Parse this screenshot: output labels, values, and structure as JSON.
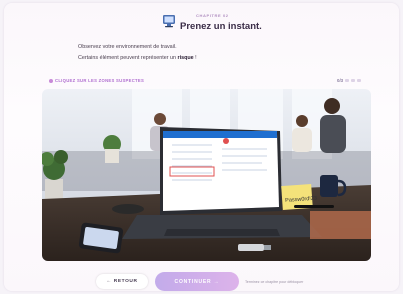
{
  "header": {
    "chapter_label": "CHAPITRE 02",
    "title": "Prenez un instant."
  },
  "intro": {
    "line1": "Observez votre environnement de travail.",
    "line2_prefix": "Certains élément peuvent représenter un ",
    "line2_bold": "risque",
    "line2_suffix": " !"
  },
  "hint": "CLIQUEZ SUR LES ZONES SUSPECTES",
  "progress": {
    "label": "0/3",
    "found": 0,
    "total": 3
  },
  "scene": {
    "sticky_note": "Passw0rd!23",
    "colors": {
      "sky": "#dfe6f0",
      "desk": "#3a2f2a",
      "laptop": "#2b2d33",
      "screen": "#ffffff",
      "accent": "#1f6fd0"
    },
    "icons": [
      "laptop",
      "smartphone",
      "sticky-note",
      "usb-key",
      "mug",
      "plant"
    ]
  },
  "footer": {
    "back_label": "← RETOUR",
    "next_label": "CONTINUER →",
    "note": "Terminez ce chapitre pour débloquer"
  }
}
